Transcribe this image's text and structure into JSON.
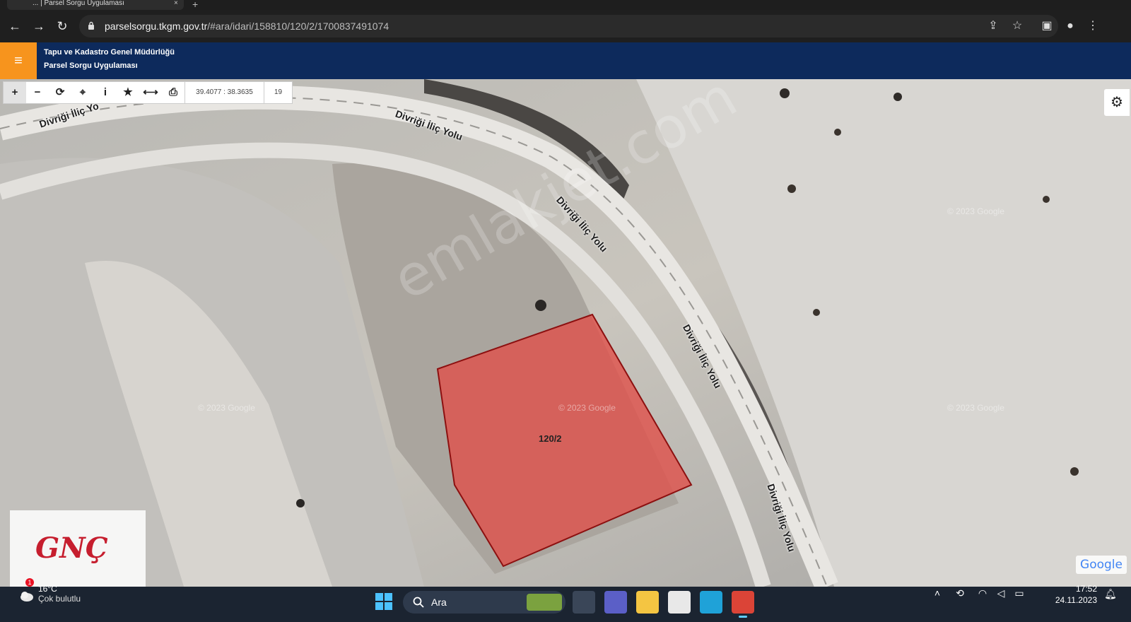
{
  "browser": {
    "tab_title": "... | Parsel Sorgu Uygulaması",
    "tab_close": "×",
    "new_tab": "+",
    "url_host": "parselsorgu.tkgm.gov.tr",
    "url_path": "/#ara/idari/158810/120/2/1700837491074",
    "icons": [
      "back-icon",
      "forward-icon",
      "reload-icon",
      "lock-icon",
      "share-icon",
      "star-icon",
      "sidepanel-icon",
      "profile-icon",
      "more-icon"
    ]
  },
  "header": {
    "menu_icon": "≡",
    "org_name": "Tapu ve Kadastro Genel Müdürlüğü",
    "app_name": "Parsel Sorgu Uygulaması",
    "colors": {
      "header_bg": "#0d2a5c",
      "menu_bg": "#f7941d"
    }
  },
  "map": {
    "tools": [
      {
        "name": "zoom-in",
        "glyph": "+"
      },
      {
        "name": "zoom-out",
        "glyph": "−"
      },
      {
        "name": "refresh",
        "glyph": "⟳"
      },
      {
        "name": "locate",
        "glyph": "⌖"
      },
      {
        "name": "info",
        "glyph": "i"
      },
      {
        "name": "favorite",
        "glyph": "★"
      },
      {
        "name": "measure",
        "glyph": "⟷"
      },
      {
        "name": "print",
        "glyph": "⎙"
      }
    ],
    "coordinates": "39.4077 : 38.3635",
    "zoom_level": "19",
    "road_name": "Divriği İliç Yolu",
    "road_name_partial": "Divriği İliç Yo",
    "parcel_label": "120/2",
    "parcel_color": "#e0504a",
    "watermark": "emlakjet.com",
    "google_copyright": "© 2023 Google",
    "google_logo": "Google",
    "settings_icon": "⚙"
  },
  "overlay_logo": {
    "text": "GNÇ",
    "color": "#c61e2e"
  },
  "taskbar": {
    "weather_badge": "1",
    "temperature": "16°C",
    "weather_desc": "Çok bulutlu",
    "search_placeholder": "Ara",
    "time": "17:52",
    "date": "24.11.2023",
    "apps": [
      "task-view",
      "teams",
      "file-explorer",
      "store",
      "edge",
      "chrome"
    ]
  }
}
